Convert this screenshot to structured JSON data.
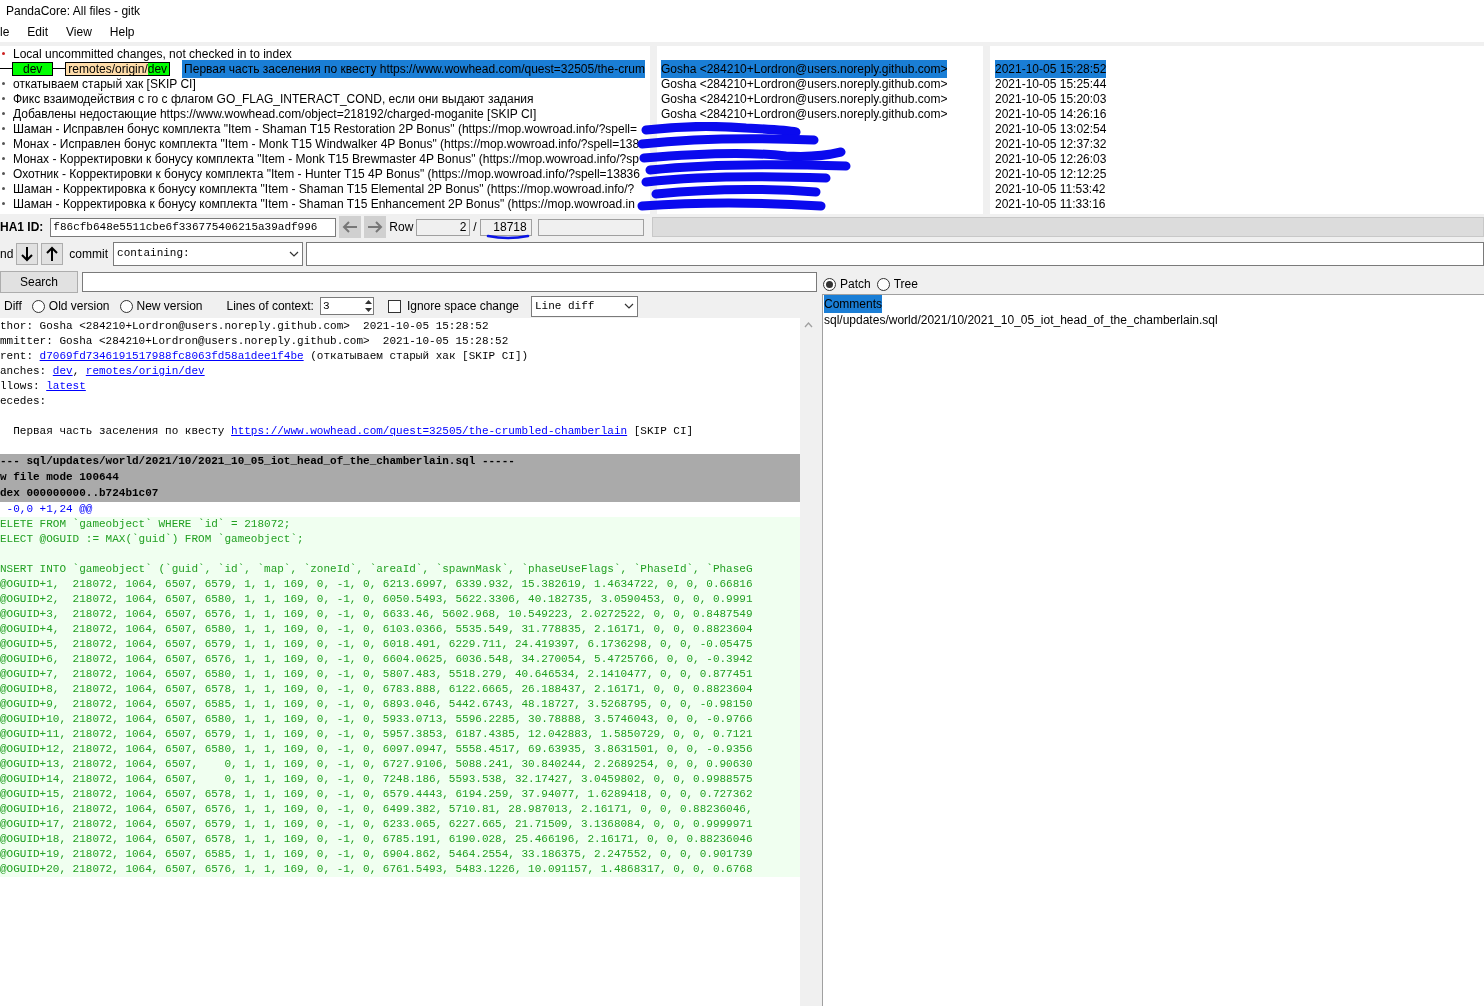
{
  "window": {
    "title": "PandaCore: All files - gitk"
  },
  "menu": [
    "le",
    "Edit",
    "View",
    "Help"
  ],
  "commits": [
    {
      "kind": "local",
      "message": "Local uncommitted changes, not checked in to index",
      "selected": false
    },
    {
      "kind": "commit",
      "tags": [
        {
          "kind": "local",
          "name": "dev"
        },
        {
          "kind": "remote",
          "prefix": "remotes/origin/",
          "name": "dev"
        }
      ],
      "message": "Первая часть заселения по квесту https://www.wowhead.com/quest=32505/the-crum",
      "author": "Gosha <284210+Lordron@users.noreply.github.com>",
      "date": "2021-10-05 15:28:52",
      "selected": true
    },
    {
      "kind": "commit",
      "message": "откатываем старый хак [SKIP CI]",
      "author": "Gosha <284210+Lordron@users.noreply.github.com>",
      "date": "2021-10-05 15:25:44",
      "selected": false
    },
    {
      "kind": "commit",
      "message": "Фикс взаимодействия с го с флагом GO_FLAG_INTERACT_COND, если они выдают задания",
      "author": "Gosha <284210+Lordron@users.noreply.github.com>",
      "date": "2021-10-05 15:20:03",
      "selected": false
    },
    {
      "kind": "commit",
      "message": "Добавлены недостающие https://www.wowhead.com/object=218192/charged-moganite [SKIP CI]",
      "author": "Gosha <284210+Lordron@users.noreply.github.com>",
      "date": "2021-10-05 14:26:16",
      "selected": false
    },
    {
      "kind": "commit",
      "message": "Шаман - Исправлен бонус комплекта \"Item - Shaman T15 Restoration 2P Bonus\" (https://mop.wowroad.info/?spell=",
      "date": "2021-10-05 13:02:54",
      "selected": false
    },
    {
      "kind": "commit",
      "message": "Монах - Исправлен бонус комплекта \"Item - Monk T15 Windwalker 4P Bonus\" (https://mop.wowroad.info/?spell=138",
      "date": "2021-10-05 12:37:32",
      "selected": false
    },
    {
      "kind": "commit",
      "message": "Монах - Корректировки к бонусу комплекта \"Item - Monk T15 Brewmaster 4P Bonus\" (https://mop.wowroad.info/?sp",
      "date": "2021-10-05 12:26:03",
      "selected": false
    },
    {
      "kind": "commit",
      "message": "Охотник - Корректировки к бонусу комплекта \"Item - Hunter T15 4P Bonus\" (https://mop.wowroad.info/?spell=13836",
      "date": "2021-10-05 12:12:25",
      "selected": false
    },
    {
      "kind": "commit",
      "message": "Шаман - Корректировка к бонусу комплекта \"Item - Shaman T15 Elemental 2P Bonus\" (https://mop.wowroad.info/?",
      "date": "2021-10-05 11:53:42",
      "selected": false
    },
    {
      "kind": "commit",
      "message": "Шаман - Корректировка к бонусу комплекта \"Item - Shaman T15 Enhancement 2P Bonus\" (https://mop.wowroad.in",
      "date": "2021-10-05 11:33:16",
      "selected": false
    }
  ],
  "sha_bar": {
    "label": "HA1 ID:",
    "sha": "f86cfb648e5511cbe6f336775406215a39adf996",
    "row_label": "Row",
    "row": "2",
    "separator": "/",
    "total": "18718"
  },
  "find_bar": {
    "label": "nd",
    "commit_label": "commit",
    "mode": "containing:"
  },
  "search": {
    "button": "Search"
  },
  "diff_options": {
    "label": "Diff",
    "modes": [
      {
        "label": "Old version",
        "selected": false
      },
      {
        "label": "New version",
        "selected": false
      }
    ],
    "context_label": "Lines of context:",
    "context": "3",
    "ignore_space": {
      "label": "Ignore space change",
      "checked": false
    },
    "diff_style": "Line diff"
  },
  "diff_lines": [
    {
      "kind": "meta",
      "segments": [
        {
          "text": "thor: Gosha <284210+Lordron@users.noreply.github.com>  2021-10-05 15:28:52"
        }
      ]
    },
    {
      "kind": "meta",
      "segments": [
        {
          "text": "mmitter: Gosha <284210+Lordron@users.noreply.github.com>  2021-10-05 15:28:52"
        }
      ]
    },
    {
      "kind": "meta",
      "segments": [
        {
          "text": "rent: "
        },
        {
          "text": "d7069fd7346191517988fc8063fd58a1dee1f4be",
          "kind": "link"
        },
        {
          "text": " (откатываем старый хак [SKIP CI])"
        }
      ]
    },
    {
      "kind": "meta",
      "segments": [
        {
          "text": "anches: "
        },
        {
          "text": "dev",
          "kind": "link"
        },
        {
          "text": ", "
        },
        {
          "text": "remotes/origin/dev",
          "kind": "link"
        }
      ]
    },
    {
      "kind": "meta",
      "segments": [
        {
          "text": "llows: "
        },
        {
          "text": "latest",
          "kind": "link"
        }
      ]
    },
    {
      "kind": "meta",
      "segments": [
        {
          "text": "ecedes:"
        }
      ]
    },
    {
      "kind": "blank"
    },
    {
      "kind": "meta",
      "segments": [
        {
          "text": "  Первая часть заселения по квесту "
        },
        {
          "text": "https://www.wowhead.com/quest=32505/the-crumbled-chamberlain",
          "kind": "link"
        },
        {
          "text": " [SKIP CI]"
        }
      ]
    },
    {
      "kind": "blank"
    },
    {
      "kind": "file_header",
      "segments": [
        {
          "text": "--- sql/updates/world/2021/10/2021_10_05_iot_head_of_the_chamberlain.sql -----"
        }
      ]
    },
    {
      "kind": "file_header",
      "segments": [
        {
          "text": "w file mode 100644"
        }
      ]
    },
    {
      "kind": "file_header",
      "segments": [
        {
          "text": "dex 000000000..b724b1c07"
        }
      ]
    },
    {
      "kind": "hunk",
      "segments": [
        {
          "text": " -0,0 +1,24 @@"
        }
      ]
    },
    {
      "kind": "added",
      "segments": [
        {
          "text": "ELETE FROM `gameobject` WHERE `id` = 218072;"
        }
      ]
    },
    {
      "kind": "added",
      "segments": [
        {
          "text": "ELECT @OGUID := MAX(`guid`) FROM `gameobject`;"
        }
      ]
    },
    {
      "kind": "added"
    },
    {
      "kind": "added",
      "segments": [
        {
          "text": "NSERT INTO `gameobject` (`guid`, `id`, `map`, `zoneId`, `areaId`, `spawnMask`, `phaseUseFlags`, `PhaseId`, `PhaseG"
        }
      ]
    },
    {
      "kind": "added",
      "segments": [
        {
          "text": "@OGUID+1,  218072, 1064, 6507, 6579, 1, 1, 169, 0, -1, 0, 6213.6997, 6339.932, 15.382619, 1.4634722, 0, 0, 0.66816"
        }
      ]
    },
    {
      "kind": "added",
      "segments": [
        {
          "text": "@OGUID+2,  218072, 1064, 6507, 6580, 1, 1, 169, 0, -1, 0, 6050.5493, 5622.3306, 40.182735, 3.0590453, 0, 0, 0.9991"
        }
      ]
    },
    {
      "kind": "added",
      "segments": [
        {
          "text": "@OGUID+3,  218072, 1064, 6507, 6576, 1, 1, 169, 0, -1, 0, 6633.46, 5602.968, 10.549223, 2.0272522, 0, 0, 0.8487549"
        }
      ]
    },
    {
      "kind": "added",
      "segments": [
        {
          "text": "@OGUID+4,  218072, 1064, 6507, 6580, 1, 1, 169, 0, -1, 0, 6103.0366, 5535.549, 31.778835, 2.16171, 0, 0, 0.8823604"
        }
      ]
    },
    {
      "kind": "added",
      "segments": [
        {
          "text": "@OGUID+5,  218072, 1064, 6507, 6579, 1, 1, 169, 0, -1, 0, 6018.491, 6229.711, 24.419397, 6.1736298, 0, 0, -0.05475"
        }
      ]
    },
    {
      "kind": "added",
      "segments": [
        {
          "text": "@OGUID+6,  218072, 1064, 6507, 6576, 1, 1, 169, 0, -1, 0, 6604.0625, 6036.548, 34.270054, 5.4725766, 0, 0, -0.3942"
        }
      ]
    },
    {
      "kind": "added",
      "segments": [
        {
          "text": "@OGUID+7,  218072, 1064, 6507, 6580, 1, 1, 169, 0, -1, 0, 5807.483, 5518.279, 40.646534, 2.1410477, 0, 0, 0.877451"
        }
      ]
    },
    {
      "kind": "added",
      "segments": [
        {
          "text": "@OGUID+8,  218072, 1064, 6507, 6578, 1, 1, 169, 0, -1, 0, 6783.888, 6122.6665, 26.188437, 2.16171, 0, 0, 0.8823604"
        }
      ]
    },
    {
      "kind": "added",
      "segments": [
        {
          "text": "@OGUID+9,  218072, 1064, 6507, 6585, 1, 1, 169, 0, -1, 0, 6893.046, 5442.6743, 48.18727, 3.5268795, 0, 0, -0.98150"
        }
      ]
    },
    {
      "kind": "added",
      "segments": [
        {
          "text": "@OGUID+10, 218072, 1064, 6507, 6580, 1, 1, 169, 0, -1, 0, 5933.0713, 5596.2285, 30.78888, 3.5746043, 0, 0, -0.9766"
        }
      ]
    },
    {
      "kind": "added",
      "segments": [
        {
          "text": "@OGUID+11, 218072, 1064, 6507, 6579, 1, 1, 169, 0, -1, 0, 5957.3853, 6187.4385, 12.042883, 1.5850729, 0, 0, 0.7121"
        }
      ]
    },
    {
      "kind": "added",
      "segments": [
        {
          "text": "@OGUID+12, 218072, 1064, 6507, 6580, 1, 1, 169, 0, -1, 0, 6097.0947, 5558.4517, 69.63935, 3.8631501, 0, 0, -0.9356"
        }
      ]
    },
    {
      "kind": "added",
      "segments": [
        {
          "text": "@OGUID+13, 218072, 1064, 6507,    0, 1, 1, 169, 0, -1, 0, 6727.9106, 5088.241, 30.840244, 2.2689254, 0, 0, 0.90630"
        }
      ]
    },
    {
      "kind": "added",
      "segments": [
        {
          "text": "@OGUID+14, 218072, 1064, 6507,    0, 1, 1, 169, 0, -1, 0, 7248.186, 5593.538, 32.17427, 3.0459802, 0, 0, 0.9988575"
        }
      ]
    },
    {
      "kind": "added",
      "segments": [
        {
          "text": "@OGUID+15, 218072, 1064, 6507, 6578, 1, 1, 169, 0, -1, 0, 6579.4443, 6194.259, 37.94077, 1.6289418, 0, 0, 0.727362"
        }
      ]
    },
    {
      "kind": "added",
      "segments": [
        {
          "text": "@OGUID+16, 218072, 1064, 6507, 6576, 1, 1, 169, 0, -1, 0, 6499.382, 5710.81, 28.987013, 2.16171, 0, 0, 0.88236046,"
        }
      ]
    },
    {
      "kind": "added",
      "segments": [
        {
          "text": "@OGUID+17, 218072, 1064, 6507, 6579, 1, 1, 169, 0, -1, 0, 6233.065, 6227.665, 21.71509, 3.1368084, 0, 0, 0.9999971"
        }
      ]
    },
    {
      "kind": "added",
      "segments": [
        {
          "text": "@OGUID+18, 218072, 1064, 6507, 6578, 1, 1, 169, 0, -1, 0, 6785.191, 6190.028, 25.466196, 2.16171, 0, 0, 0.88236046"
        }
      ]
    },
    {
      "kind": "added",
      "segments": [
        {
          "text": "@OGUID+19, 218072, 1064, 6507, 6585, 1, 1, 169, 0, -1, 0, 6904.862, 5464.2554, 33.186375, 2.247552, 0, 0, 0.901739"
        }
      ]
    },
    {
      "kind": "added",
      "segments": [
        {
          "text": "@OGUID+20, 218072, 1064, 6507, 6576, 1, 1, 169, 0, -1, 0, 6761.5493, 5483.1226, 10.091157, 1.4868317, 0, 0, 0.6768"
        }
      ]
    }
  ],
  "view_modes": [
    {
      "label": "Patch",
      "selected": true
    },
    {
      "label": "Tree",
      "selected": false
    }
  ],
  "files": [
    {
      "label": "Comments",
      "selected": true
    },
    {
      "label": "sql/updates/world/2021/10/2021_10_05_iot_head_of_the_chamberlain.sql",
      "selected": false
    }
  ]
}
